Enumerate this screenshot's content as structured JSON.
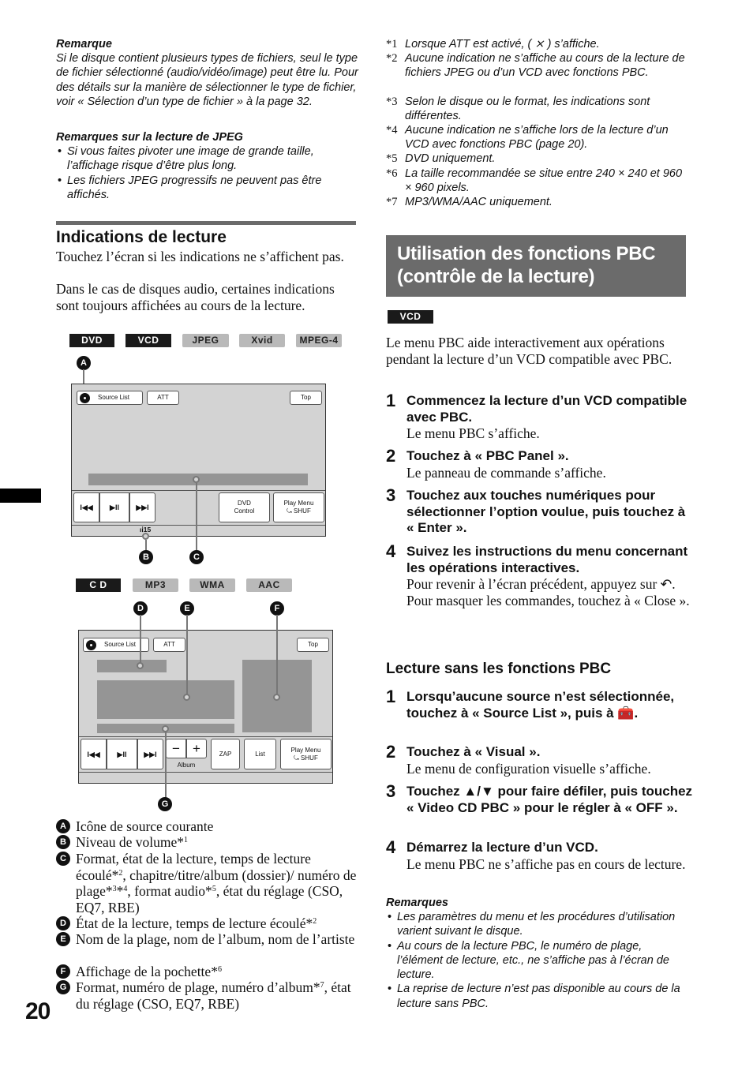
{
  "page": {
    "number": "20"
  },
  "left": {
    "remarque": {
      "title": "Remarque",
      "text": "Si le disque contient plusieurs types de fichiers, seul le type de fichier sélectionné (audio/vidéo/image) peut être lu. Pour des détails sur la manière de sélectionner le type de fichier, voir « Sélection d’un type de fichier » à la page 32."
    },
    "jpeg_notes": {
      "title": "Remarques sur la lecture de JPEG",
      "bullets": [
        "Si vous faites pivoter une image de grande taille, l’affichage risque d’être plus long.",
        "Les fichiers JPEG progressifs ne peuvent pas être affichés."
      ]
    },
    "section": {
      "title": "Indications de lecture",
      "para1": "Touchez l’écran si les indications ne s’affichent pas.",
      "para2": "Dans le cas de disques audio, certaines indications sont toujours affichées au cours de la lecture."
    },
    "figure1": {
      "tags": [
        {
          "label": "DVD",
          "style": "dark"
        },
        {
          "label": "VCD",
          "style": "dark"
        },
        {
          "label": "JPEG",
          "style": "light"
        },
        {
          "label": "Xvid",
          "style": "light"
        },
        {
          "label": "MPEG-4",
          "style": "light"
        }
      ],
      "buttons": {
        "source_list": "Source List",
        "att": "ATT",
        "top": "Top",
        "prev": "I◀◀",
        "play_pause": "▶II",
        "next": "▶▶I",
        "dvd_control_1": "DVD",
        "dvd_control_2": "Control",
        "play_menu": "Play Menu",
        "shuf": "SHUF"
      },
      "volume": "15",
      "callouts": [
        "A",
        "B",
        "C"
      ]
    },
    "figure2": {
      "tags": [
        {
          "label": "C D",
          "style": "dark"
        },
        {
          "label": "MP3",
          "style": "light"
        },
        {
          "label": "WMA",
          "style": "light"
        },
        {
          "label": "AAC",
          "style": "light"
        }
      ],
      "buttons": {
        "source_list": "Source List",
        "att": "ATT",
        "top": "Top",
        "prev": "I◀◀",
        "play_pause": "▶II",
        "next": "▶▶I",
        "minus": "−",
        "plus": "+",
        "album": "Album",
        "zap": "ZAP",
        "list": "List",
        "play_menu": "Play Menu",
        "shuf": "SHUF"
      },
      "callouts": [
        "D",
        "E",
        "F",
        "G"
      ]
    },
    "legend": [
      {
        "key": "A",
        "text": "Icône de source courante",
        "html": "Icône de source courante"
      },
      {
        "key": "B",
        "text": "Niveau de volume*1",
        "html": "Niveau de volume*<sup>1</sup>"
      },
      {
        "key": "C",
        "text": "Format, état de la lecture, temps de lecture écoulé*2, chapitre/titre/album (dossier)/ numéro de plage*3*4, format audio*5, état du réglage (CSO, EQ7, RBE)",
        "html": "Format, état de la lecture, temps de lecture écoulé*<sup>2</sup>, chapitre/titre/album (dossier)/ numéro de plage*<sup>3</sup>*<sup>4</sup>, format audio*<sup>5</sup>, état du réglage (CSO, EQ7, RBE)"
      },
      {
        "key": "D",
        "text": "État de la lecture, temps de lecture écoulé*2",
        "html": "État de la lecture, temps de lecture écoulé*<sup>2</sup>"
      },
      {
        "key": "E",
        "text": "Nom de la plage, nom de l’album, nom de l’artiste",
        "html": "Nom de la plage, nom de l’album, nom de l’artiste"
      },
      {
        "key": "F",
        "text": "Affichage de la pochette*6",
        "html": "Affichage de la pochette*<sup>6</sup>"
      },
      {
        "key": "G",
        "text": "Format, numéro de plage, numéro d’album*7, état du réglage (CSO, EQ7, RBE)",
        "html": "Format, numéro de plage, numéro d’album*<sup>7</sup>, état du réglage (CSO, EQ7, RBE)"
      }
    ]
  },
  "right": {
    "footnotes": [
      {
        "num": "*1",
        "text": "Lorsque ATT est activé, ( ⨯ ) s’affiche."
      },
      {
        "num": "*2",
        "text": "Aucune indication ne s’affiche au cours de la lecture de fichiers JPEG ou d’un VCD avec fonctions PBC."
      },
      {
        "num": "*3",
        "text": "Selon le disque ou le format, les indications sont différentes."
      },
      {
        "num": "*4",
        "text": "Aucune indication ne s’affiche lors de la lecture d’un VCD avec fonctions PBC (page 20)."
      },
      {
        "num": "*5",
        "text": "DVD uniquement."
      },
      {
        "num": "*6",
        "text": "La taille recommandée se situe entre 240 × 240 et 960 × 960 pixels."
      },
      {
        "num": "*7",
        "text": "MP3/WMA/AAC uniquement."
      }
    ],
    "banner": {
      "line1": "Utilisation des fonctions PBC",
      "line2": "(contrôle de la lecture)"
    },
    "tag": "VCD",
    "intro": "Le menu PBC aide interactivement aux opérations pendant la lecture d’un VCD compatible avec PBC.",
    "steps": [
      {
        "n": "1",
        "title": "Commencez la lecture d’un VCD compatible avec PBC.",
        "desc": "Le menu PBC s’affiche."
      },
      {
        "n": "2",
        "title": "Touchez à « PBC Panel ».",
        "desc": "Le panneau de commande s’affiche."
      },
      {
        "n": "3",
        "title": "Touchez aux touches numériques pour sélectionner l’option voulue, puis touchez à « Enter ».",
        "desc": ""
      },
      {
        "n": "4",
        "title": "Suivez les instructions du menu concernant les opérations interactives.",
        "desc": "Pour revenir à l’écran précédent, appuyez sur ↶.",
        "desc2": "Pour masquer les commandes, touchez à « Close »."
      }
    ],
    "subsection": {
      "title": "Lecture sans les fonctions PBC",
      "steps": [
        {
          "n": "1",
          "title": "Lorsqu’aucune source n’est sélectionnée, touchez à « Source List », puis à 🧰.",
          "desc": ""
        },
        {
          "n": "2",
          "title": "Touchez à « Visual ».",
          "desc": "Le menu de configuration visuelle s’affiche."
        },
        {
          "n": "3",
          "title": "Touchez ▲/▼ pour faire défiler, puis touchez « Video CD PBC » pour le régler à « OFF ».",
          "desc": ""
        },
        {
          "n": "4",
          "title": "Démarrez la lecture d’un VCD.",
          "desc": "Le menu PBC ne s’affiche pas en cours de lecture."
        }
      ]
    },
    "remarques": {
      "title": "Remarques",
      "bullets": [
        "Les paramètres du menu et les procédures d’utilisation varient suivant le disque.",
        "Au cours de la lecture PBC, le numéro de plage, l’élément de lecture, etc., ne s’affiche pas à l’écran de lecture.",
        "La reprise de lecture n’est pas disponible au cours de la lecture sans PBC."
      ]
    }
  }
}
